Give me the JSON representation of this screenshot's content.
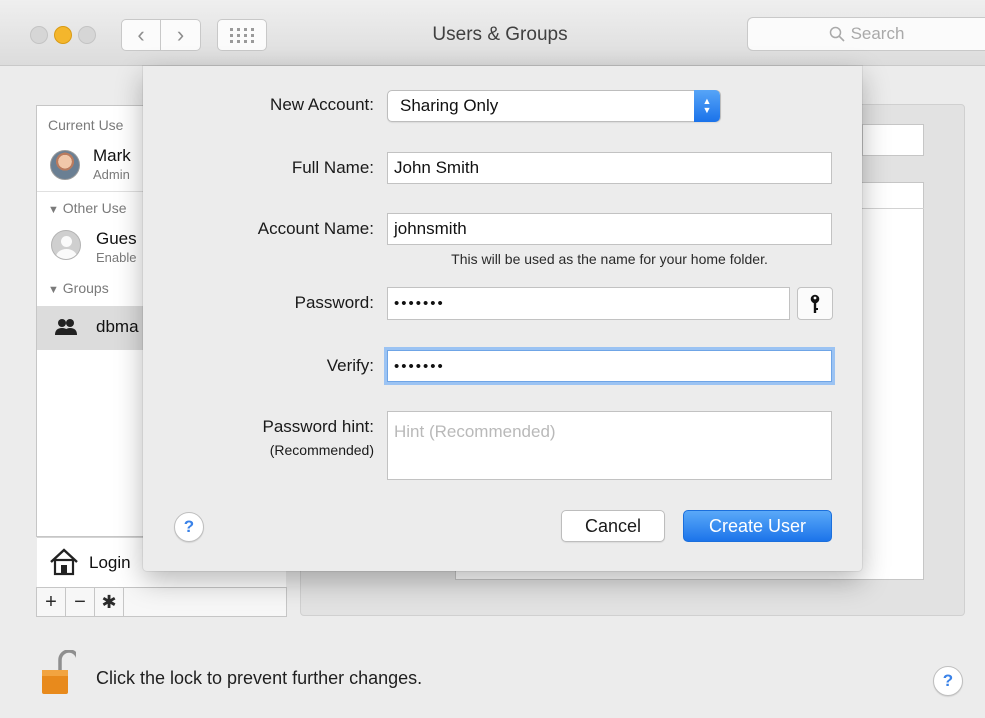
{
  "window": {
    "title": "Users & Groups",
    "search_placeholder": "Search"
  },
  "sidebar": {
    "current_users_header": "Current Use",
    "current_user": {
      "name": "Mark",
      "role": "Admin"
    },
    "other_users_header": "Other Use",
    "guest": {
      "name": "Gues",
      "status": "Enable"
    },
    "groups_header": "Groups",
    "group": {
      "name": "dbma"
    },
    "login_label": "Login",
    "add_label": "+",
    "remove_label": "−"
  },
  "sheet": {
    "new_account_label": "New Account:",
    "new_account_value": "Sharing Only",
    "full_name_label": "Full Name:",
    "full_name_value": "John Smith",
    "account_name_label": "Account Name:",
    "account_name_value": "johnsmith",
    "account_name_note": "This will be used as the name for your home folder.",
    "password_label": "Password:",
    "password_value": "•••••••",
    "verify_label": "Verify:",
    "verify_value": "•••••••",
    "hint_label": "Password hint:",
    "hint_sublabel": "(Recommended)",
    "hint_placeholder": "Hint (Recommended)",
    "help_label": "?",
    "cancel_label": "Cancel",
    "create_label": "Create User"
  },
  "footer": {
    "lock_text": "Click the lock to prevent further changes.",
    "help_label": "?"
  },
  "colors": {
    "accent": "#1c74ea",
    "focus_ring": "#9bc3f3",
    "traffic_minimize": "#f4b62c"
  }
}
